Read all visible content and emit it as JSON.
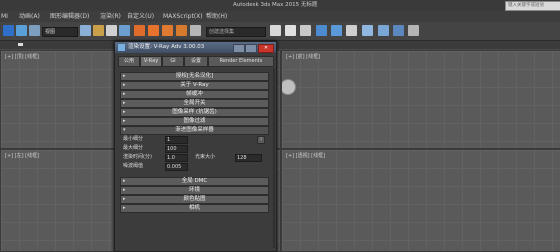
{
  "app": {
    "title": "Autodesk 3ds Max 2015    无标题",
    "search_placeholder": "键入关键字或短语"
  },
  "menu": [
    {
      "label": "MI"
    },
    {
      "label": "动画(A)"
    },
    {
      "label": "图形编辑器(D)"
    },
    {
      "label": "渲染(R)"
    },
    {
      "label": "自定义(U)"
    },
    {
      "label": "MAXScript(X)"
    },
    {
      "label": "帮助(H)"
    }
  ],
  "toolbar": {
    "view_dropdown": "视图",
    "selection_set": "创建选择集"
  },
  "viewports": [
    {
      "label": "[+] [顶] [线框]"
    },
    {
      "label": "[+] [前] [线框]"
    },
    {
      "label": "[+] [左] [线框]"
    },
    {
      "label": "[+] [透视] [线框]"
    }
  ],
  "dialog": {
    "title": "渲染设置: V-Ray Adv 3.00.03",
    "tabs": [
      {
        "label": "公用"
      },
      {
        "label": "V-Ray"
      },
      {
        "label": "GI"
      },
      {
        "label": "设置"
      },
      {
        "label": "Render Elements"
      }
    ],
    "rollouts_top": [
      {
        "label": "授权[无名汉化]"
      },
      {
        "label": "关于 V-Ray"
      },
      {
        "label": "帧缓冲"
      },
      {
        "label": "全局开关"
      },
      {
        "label": "图像采样 (抗锯齿)"
      },
      {
        "label": "图像过滤"
      }
    ],
    "active_rollout": {
      "label": "渐进图像采样器"
    },
    "params": [
      {
        "label": "最小细分",
        "value": "1"
      },
      {
        "label": "最大细分",
        "value": "100"
      },
      {
        "label": "渲染时间(分)",
        "value": "1.0"
      },
      {
        "label": "噪波阈值",
        "value": "0.005"
      }
    ],
    "bundle_size": {
      "label": "光束大小",
      "value": "128"
    },
    "rollouts_bottom": [
      {
        "label": "全局 DMC"
      },
      {
        "label": "环境"
      },
      {
        "label": "颜色贴图"
      },
      {
        "label": "相机"
      }
    ]
  },
  "colors": {
    "accent": "#4a5a72",
    "viewport_bg": "#5a5a5a"
  }
}
